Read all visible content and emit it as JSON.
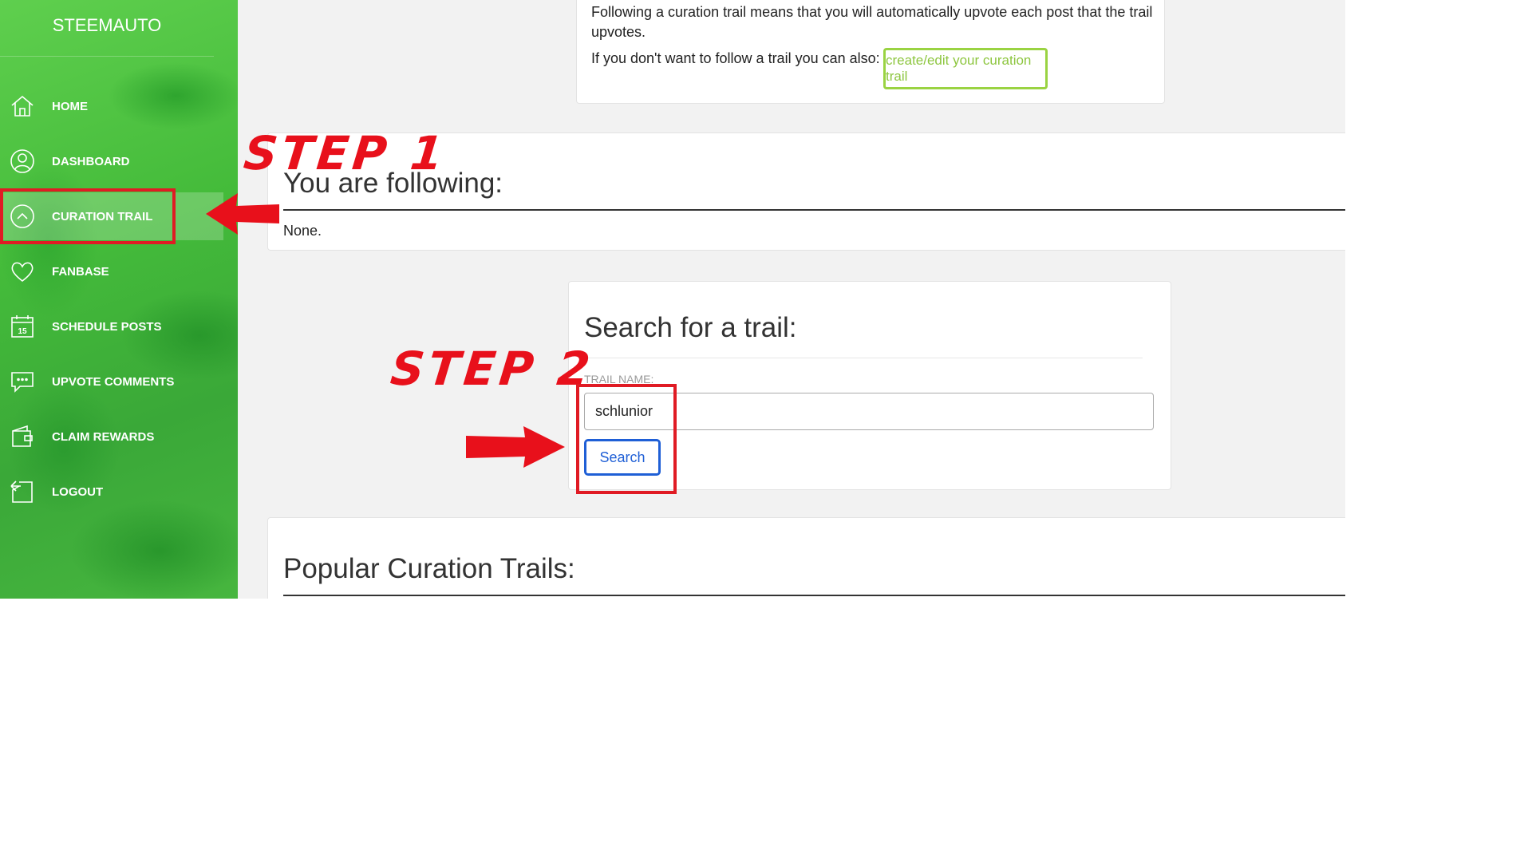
{
  "brand": "STEEMAUTO",
  "nav": [
    {
      "label": "HOME",
      "icon": "home-icon"
    },
    {
      "label": "DASHBOARD",
      "icon": "user-circle-icon"
    },
    {
      "label": "CURATION TRAIL",
      "icon": "chevron-up-circle-icon",
      "active": true
    },
    {
      "label": "FANBASE",
      "icon": "heart-icon"
    },
    {
      "label": "SCHEDULE POSTS",
      "icon": "calendar-icon",
      "icon_text": "15"
    },
    {
      "label": "UPVOTE COMMENTS",
      "icon": "comment-icon"
    },
    {
      "label": "CLAIM REWARDS",
      "icon": "wallet-icon"
    },
    {
      "label": "LOGOUT",
      "icon": "logout-icon"
    }
  ],
  "info": {
    "description": "Following a curation trail means that you will automatically upvote each post that the trail upvotes.",
    "alt_text": "If you don't want to follow a trail you can also:",
    "create_button": "create/edit your curation trail"
  },
  "following": {
    "title": "You are following:",
    "value": "None."
  },
  "search": {
    "title": "Search for a trail:",
    "field_label": "TRAIL NAME:",
    "field_value": "schlunior",
    "button": "Search"
  },
  "popular": {
    "title": "Popular Curation Trails:"
  },
  "annotations": {
    "step1": "STEP 1",
    "step2": "STEP 2",
    "color": "#e01b24"
  },
  "colors": {
    "sidebar_green": "#44bb3a",
    "create_button_green": "#8dc63f",
    "search_button_blue": "#1f5fd6"
  }
}
